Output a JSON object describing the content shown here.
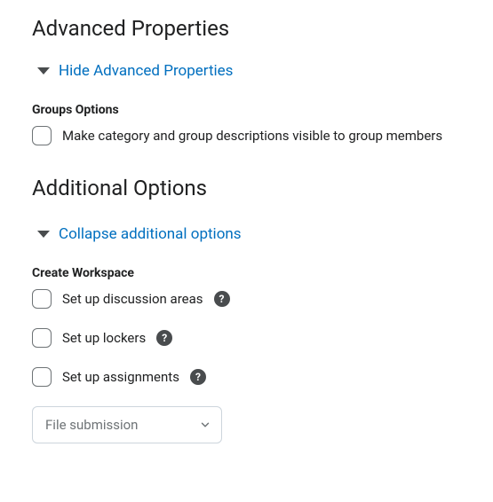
{
  "sections": {
    "advanced": {
      "heading": "Advanced Properties",
      "toggle_label": "Hide Advanced Properties",
      "groups_options": {
        "heading": "Groups Options",
        "option_label": "Make category and group descriptions visible to group members"
      }
    },
    "additional": {
      "heading": "Additional Options",
      "toggle_label": "Collapse additional options",
      "create_workspace": {
        "heading": "Create Workspace",
        "discussion_label": "Set up discussion areas",
        "lockers_label": "Set up lockers",
        "assignments_label": "Set up assignments",
        "submission_type": {
          "selected": "File submission"
        }
      }
    }
  }
}
